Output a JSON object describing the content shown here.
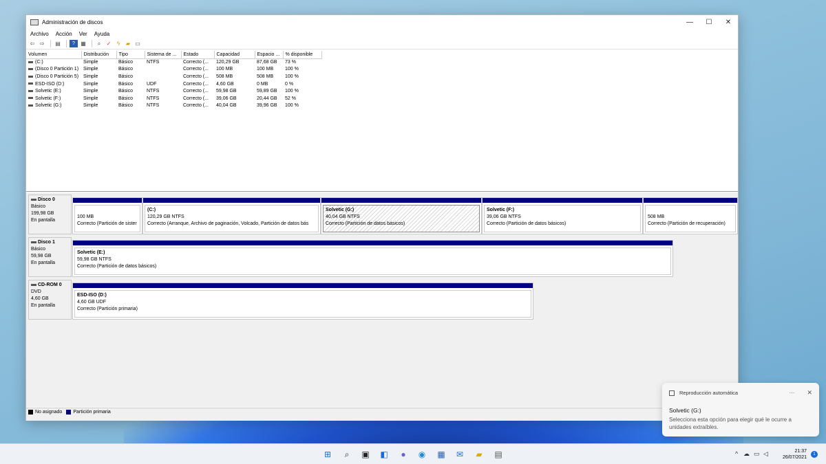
{
  "window": {
    "title": "Administración de discos",
    "controls": {
      "minimize": "—",
      "maximize": "☐",
      "close": "✕"
    }
  },
  "menu": [
    "Archivo",
    "Acción",
    "Ver",
    "Ayuda"
  ],
  "volume_list": {
    "headers": [
      "Volumen",
      "Distribución",
      "Tipo",
      "Sistema de ...",
      "Estado",
      "Capacidad",
      "Espacio ...",
      "% disponible"
    ],
    "rows": [
      [
        "(C:)",
        "Simple",
        "Básico",
        "NTFS",
        "Correcto (...",
        "120,29 GB",
        "87,68 GB",
        "73 %"
      ],
      [
        "(Disco 0 Partición 1)",
        "Simple",
        "Básico",
        "",
        "Correcto (...",
        "100 MB",
        "100 MB",
        "100 %"
      ],
      [
        "(Disco 0 Partición 5)",
        "Simple",
        "Básico",
        "",
        "Correcto (...",
        "508 MB",
        "508 MB",
        "100 %"
      ],
      [
        "ESD-ISO (D:)",
        "Simple",
        "Básico",
        "UDF",
        "Correcto (...",
        "4,60 GB",
        "0 MB",
        "0 %"
      ],
      [
        "Solvetic (E:)",
        "Simple",
        "Básico",
        "NTFS",
        "Correcto (...",
        "59,98 GB",
        "59,89 GB",
        "100 %"
      ],
      [
        "Solvetic (F:)",
        "Simple",
        "Básico",
        "NTFS",
        "Correcto (...",
        "39,06 GB",
        "20,44 GB",
        "52 %"
      ],
      [
        "Solvetic (G:)",
        "Simple",
        "Básico",
        "NTFS",
        "Correcto (...",
        "40,04 GB",
        "39,96 GB",
        "100 %"
      ]
    ]
  },
  "disks": [
    {
      "name": "Disco 0",
      "type": "Básico",
      "size": "199,98 GB",
      "status": "En pantalla",
      "partitions": [
        {
          "title": "",
          "size": "100 MB",
          "status": "Correcto (Partición de sister"
        },
        {
          "title": "(C:)",
          "size": "120,29 GB NTFS",
          "status": "Correcto (Arranque, Archivo de paginación, Volcado, Partición de datos bás"
        },
        {
          "title": "Solvetic  (G:)",
          "size": "40,04 GB NTFS",
          "status": "Correcto (Partición de datos básicos)"
        },
        {
          "title": "Solvetic  (F:)",
          "size": "39,06 GB NTFS",
          "status": "Correcto (Partición de datos básicos)"
        },
        {
          "title": "",
          "size": "508 MB",
          "status": "Correcto (Partición de recuperación)"
        }
      ]
    },
    {
      "name": "Disco 1",
      "type": "Básico",
      "size": "59,98 GB",
      "status": "En pantalla",
      "partitions": [
        {
          "title": "Solvetic  (E:)",
          "size": "59,98 GB NTFS",
          "status": "Correcto (Partición de datos básicos)"
        }
      ]
    },
    {
      "name": "CD-ROM 0",
      "type": "DVD",
      "size": "4,60 GB",
      "status": "En pantalla",
      "partitions": [
        {
          "title": "ESD-ISO  (D:)",
          "size": "4,60 GB UDF",
          "status": "Correcto (Partición primaria)"
        }
      ]
    }
  ],
  "legend": [
    {
      "label": "No asignado",
      "color": "#000000"
    },
    {
      "label": "Partición primaria",
      "color": "#000080"
    }
  ],
  "toast": {
    "header": "Reproducción automática",
    "more": "···",
    "close": "✕",
    "title": "Solvetic (G:)",
    "body": "Selecciona esta opción para elegir qué le ocurre a unidades extraíbles."
  },
  "taskbar": {
    "time": "21:37",
    "date": "26/07/2021",
    "notifications": "1"
  },
  "colors": {
    "partition_bar": "#000080",
    "selected_hatch": "#d8d8d8"
  }
}
